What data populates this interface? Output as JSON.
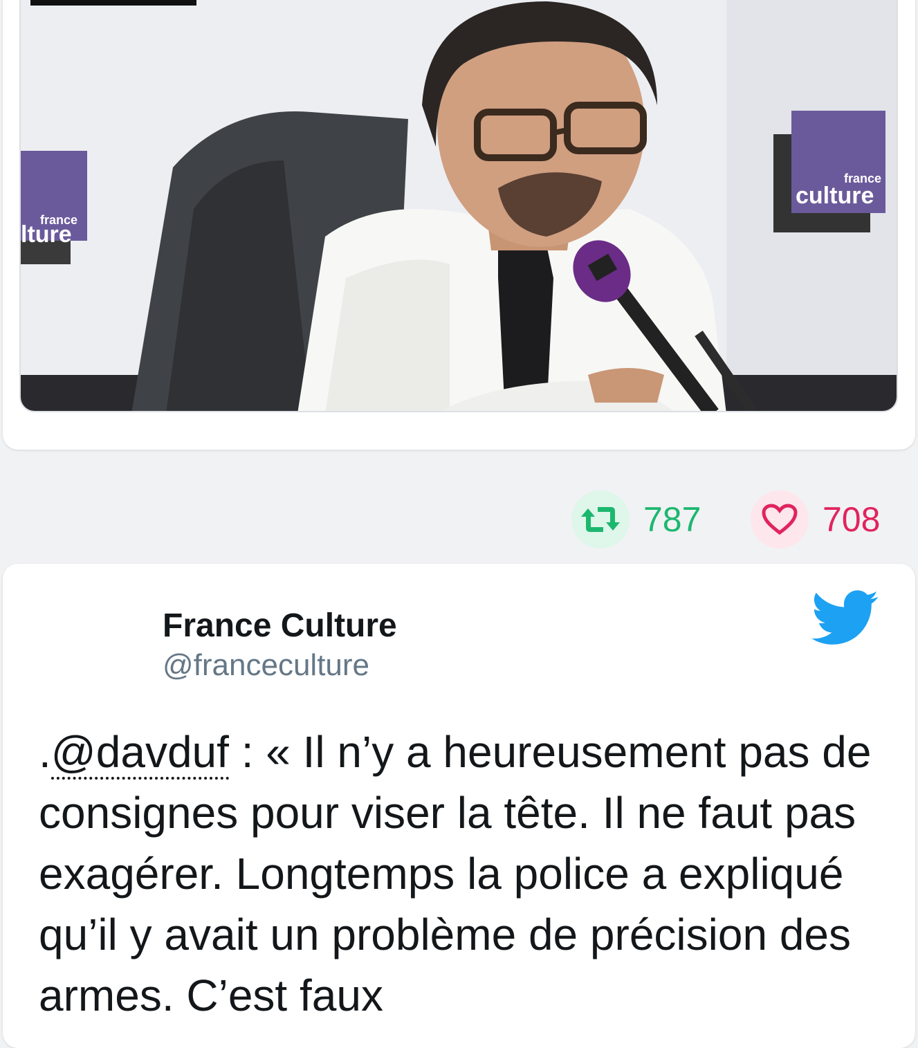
{
  "media": {
    "logo_small": "france",
    "logo_left": "lture",
    "logo_right": "culture",
    "description_alt": "photo"
  },
  "stats": {
    "retweet_icon": "retweet-icon",
    "retweets": "787",
    "like_icon": "heart-icon",
    "likes": "708",
    "retweet_color": "#1cb76f",
    "like_color": "#e0245e"
  },
  "tweet": {
    "author_name": "France Culture",
    "author_handle": "@franceculture",
    "platform_icon": "twitter-bird-icon",
    "text_prefix": ".",
    "mention": "@davduf",
    "text_body": " : « Il n’y a heureusement pas de consignes pour viser la tête. Il ne faut pas exagérer. Longtemps la police a expliqué qu’il y avait un problème de précision des armes. C’est faux"
  }
}
